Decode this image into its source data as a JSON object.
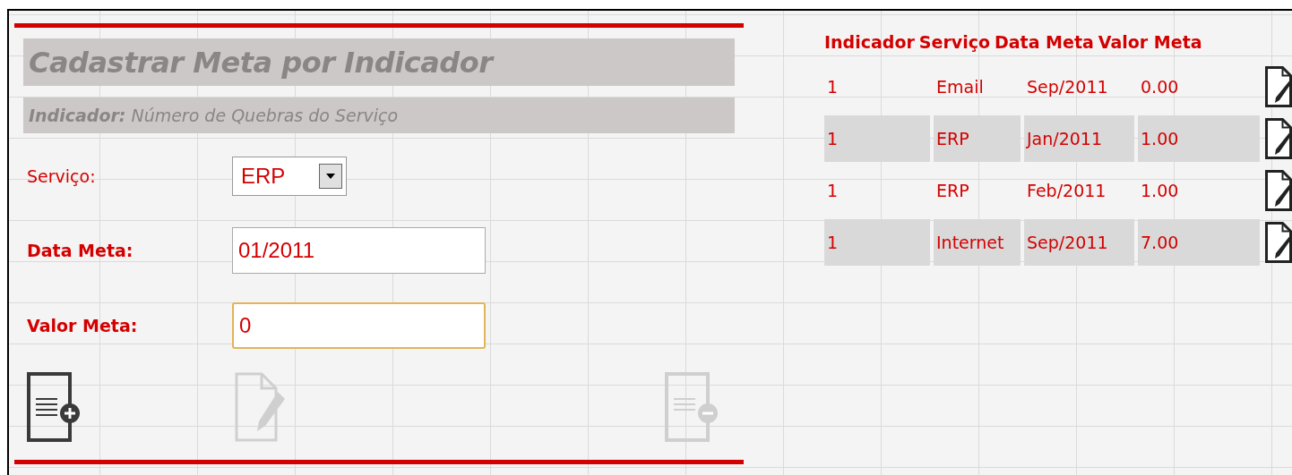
{
  "form": {
    "title": "Cadastrar Meta por Indicador",
    "indicator_label": "Indicador:",
    "indicator_value": "Número de Quebras do Serviço",
    "fields": [
      {
        "kind": "select",
        "label": "Serviço",
        "label_suffix": ":",
        "value": "ERP",
        "focused": false
      },
      {
        "kind": "input",
        "label": "Data Meta:",
        "value": "01/2011",
        "focused": false
      },
      {
        "kind": "input",
        "label": "Valor Meta:",
        "value": "0",
        "focused": true
      }
    ],
    "actions": [
      {
        "kind": "add",
        "disabled": false
      },
      {
        "kind": "edit",
        "disabled": true
      },
      {
        "kind": "delete",
        "disabled": true
      }
    ]
  },
  "table": {
    "columns": [
      "Indicador",
      "Serviço",
      "Data Meta",
      "Valor Meta"
    ],
    "rows": [
      {
        "cells": [
          "1",
          "Email",
          "Sep/2011",
          "0.00"
        ]
      },
      {
        "cells": [
          "1",
          "ERP",
          "Jan/2011",
          "1.00"
        ]
      },
      {
        "cells": [
          "1",
          "ERP",
          "Feb/2011",
          "1.00"
        ]
      },
      {
        "cells": [
          "1",
          "Internet",
          "Sep/2011",
          "7.00"
        ]
      }
    ]
  }
}
